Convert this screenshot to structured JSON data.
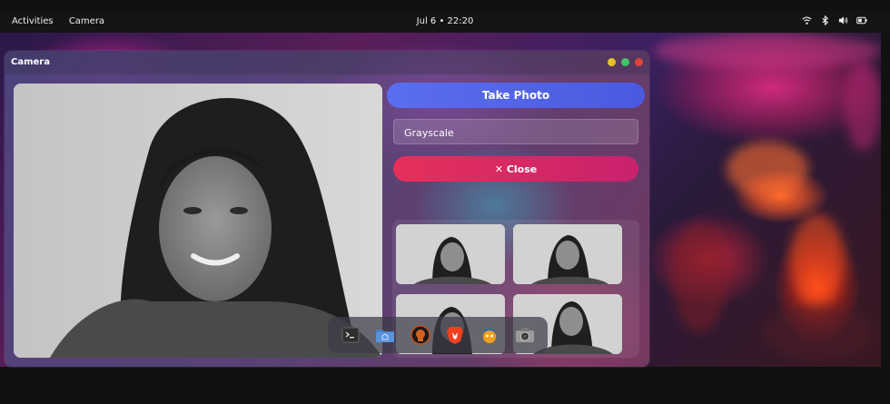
{
  "topbar": {
    "activities_label": "Activities",
    "app_label": "Camera",
    "clock": "Jul 6 • 22:20",
    "tray": [
      "wifi-icon",
      "bluetooth-icon",
      "volume-icon",
      "battery-icon"
    ]
  },
  "window": {
    "title": "Camera",
    "controls": {
      "minimize_color": "#e6c229",
      "maximize_color": "#41c463",
      "close_color": "#e0433a"
    },
    "take_photo_label": "Take Photo",
    "filter_value": "Grayscale",
    "close_label": "Close",
    "close_icon": "✕",
    "gallery": [
      "photo-thumbnail",
      "photo-thumbnail",
      "photo-thumbnail",
      "photo-thumbnail"
    ]
  },
  "dock": {
    "items": [
      "terminal-icon",
      "files-icon",
      "app-icon",
      "brave-browser-icon",
      "app-icon",
      "camera-icon"
    ]
  }
}
